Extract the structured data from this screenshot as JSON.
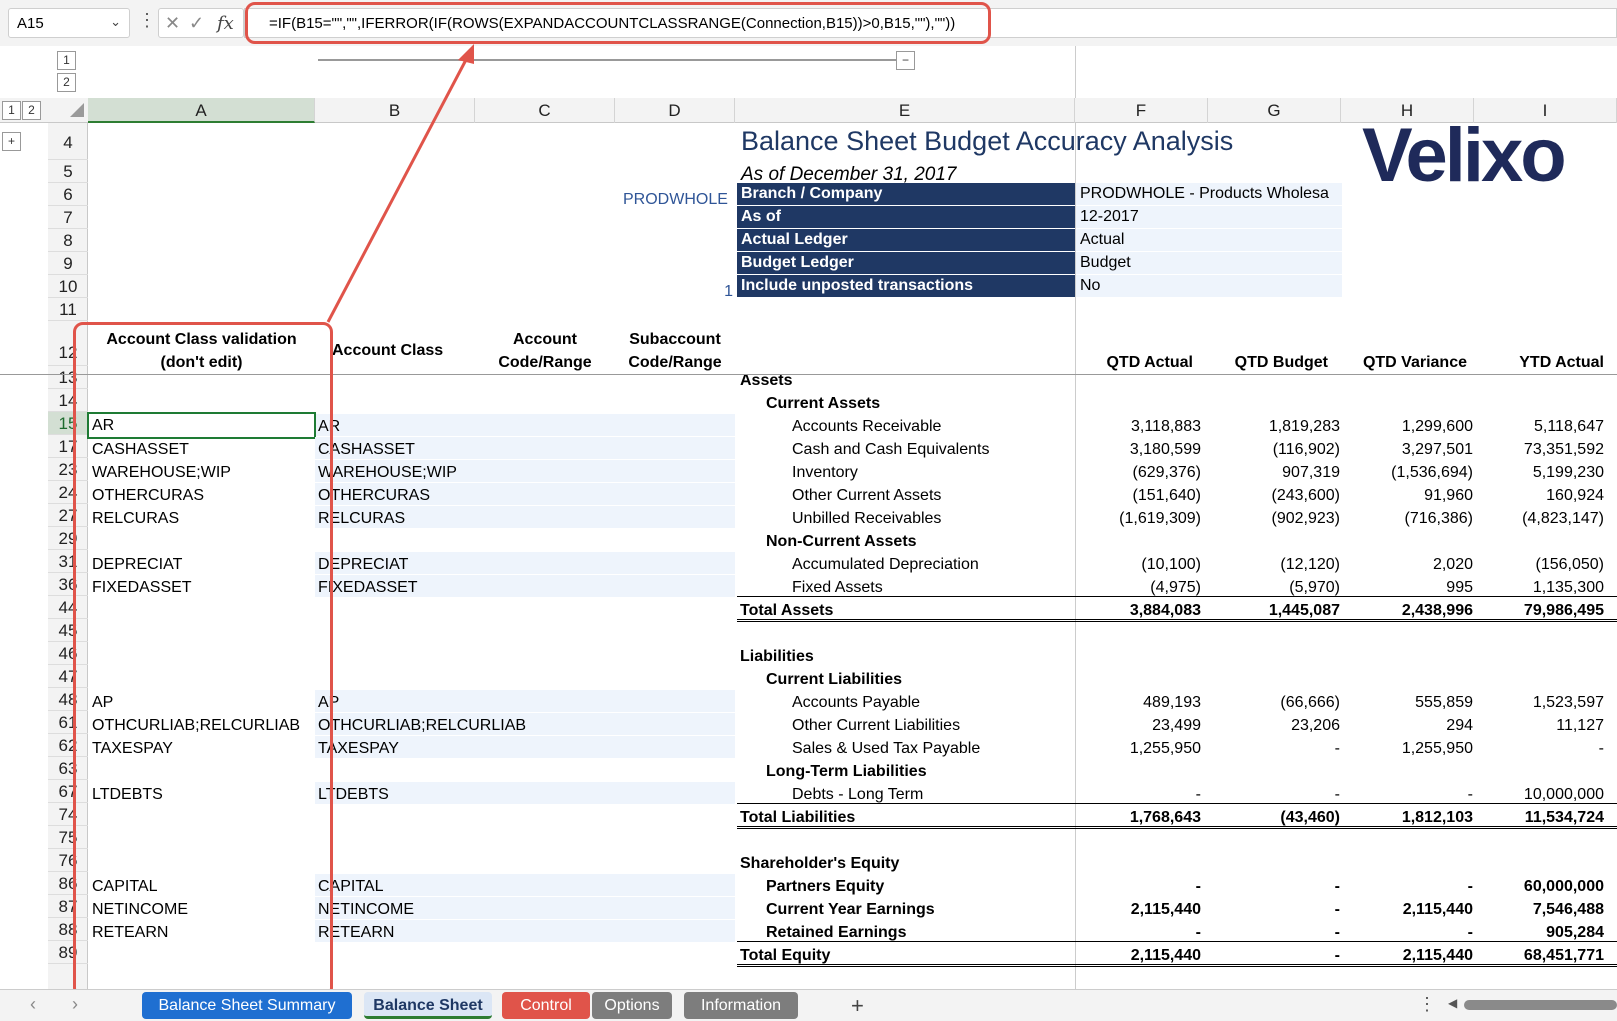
{
  "formula_bar": {
    "name_box": "A15",
    "fx": "fx",
    "formula": "=IF(B15=\"\",\"\",IFERROR(IF(ROWS(EXPANDACCOUNTCLASSRANGE(Connection,B15))>0,B15,\"\"),\"\"))"
  },
  "outline": {
    "levels": [
      "1",
      "2"
    ],
    "row_levels": [
      "1",
      "2"
    ],
    "expand": "+",
    "collapse": "−"
  },
  "columns": [
    "A",
    "B",
    "C",
    "D",
    "E",
    "F",
    "G",
    "H",
    "I"
  ],
  "rows": [
    "4",
    "5",
    "6",
    "7",
    "8",
    "9",
    "10",
    "11",
    "12",
    "13",
    "14",
    "15",
    "17",
    "23",
    "24",
    "27",
    "29",
    "31",
    "36",
    "44",
    "45",
    "46",
    "47",
    "48",
    "61",
    "62",
    "63",
    "67",
    "74",
    "75",
    "76",
    "86",
    "87",
    "88",
    "89"
  ],
  "report": {
    "title": "Balance Sheet Budget Accuracy Analysis",
    "subtitle": "As of December 31, 2017",
    "logo": "Velixo",
    "d6": "PRODWHOLE",
    "d10": "1",
    "params": [
      {
        "label": "Branch / Company",
        "value": "PRODWHOLE - Products Wholesa"
      },
      {
        "label": "As of",
        "value": "12-2017"
      },
      {
        "label": "Actual Ledger",
        "value": "Actual"
      },
      {
        "label": "Budget Ledger",
        "value": "Budget"
      },
      {
        "label": "Include unposted transactions",
        "value": "No"
      }
    ]
  },
  "headers": {
    "a": "Account Class validation (don't edit)",
    "b": "Account Class",
    "c1": "Account",
    "c2": "Code/Range",
    "d1": "Subaccount",
    "d2": "Code/Range",
    "f": "QTD Actual",
    "g": "QTD Budget",
    "h": "QTD Variance",
    "i": "YTD Actual"
  },
  "lines": [
    {
      "a": "",
      "b": "",
      "e": "Assets",
      "lvl": 0,
      "bold": true,
      "f": "",
      "g": "",
      "h": "",
      "i": ""
    },
    {
      "a": "",
      "b": "",
      "e": "Current Assets",
      "lvl": 1,
      "bold": true,
      "f": "",
      "g": "",
      "h": "",
      "i": ""
    },
    {
      "a": "AR",
      "b": "AR",
      "e": "Accounts Receivable",
      "lvl": 2,
      "bold": false,
      "f": "3,118,883",
      "g": "1,819,283",
      "h": "1,299,600",
      "i": "5,118,647"
    },
    {
      "a": "CASHASSET",
      "b": "CASHASSET",
      "e": "Cash and Cash Equivalents",
      "lvl": 2,
      "bold": false,
      "f": "3,180,599",
      "g": "(116,902)",
      "h": "3,297,501",
      "i": "73,351,592"
    },
    {
      "a": "WAREHOUSE;WIP",
      "b": "WAREHOUSE;WIP",
      "e": "Inventory",
      "lvl": 2,
      "bold": false,
      "f": "(629,376)",
      "g": "907,319",
      "h": "(1,536,694)",
      "i": "5,199,230"
    },
    {
      "a": "OTHERCURAS",
      "b": "OTHERCURAS",
      "e": "Other Current Assets",
      "lvl": 2,
      "bold": false,
      "f": "(151,640)",
      "g": "(243,600)",
      "h": "91,960",
      "i": "160,924"
    },
    {
      "a": "RELCURAS",
      "b": "RELCURAS",
      "e": "Unbilled Receivables",
      "lvl": 2,
      "bold": false,
      "f": "(1,619,309)",
      "g": "(902,923)",
      "h": "(716,386)",
      "i": "(4,823,147)"
    },
    {
      "a": "",
      "b": "",
      "e": "Non-Current Assets",
      "lvl": 1,
      "bold": true,
      "f": "",
      "g": "",
      "h": "",
      "i": ""
    },
    {
      "a": "DEPRECIAT",
      "b": "DEPRECIAT",
      "e": "Accumulated Depreciation",
      "lvl": 2,
      "bold": false,
      "f": "(10,100)",
      "g": "(12,120)",
      "h": "2,020",
      "i": "(156,050)"
    },
    {
      "a": "FIXEDASSET",
      "b": "FIXEDASSET",
      "e": "Fixed Assets",
      "lvl": 2,
      "bold": false,
      "f": "(4,975)",
      "g": "(5,970)",
      "h": "995",
      "i": "1,135,300"
    },
    {
      "a": "",
      "b": "",
      "e": "Total Assets",
      "lvl": 0,
      "bold": true,
      "total": true,
      "f": "3,884,083",
      "g": "1,445,087",
      "h": "2,438,996",
      "i": "79,986,495"
    },
    {
      "a": "",
      "b": "",
      "e": "",
      "lvl": 0,
      "bold": false,
      "f": "",
      "g": "",
      "h": "",
      "i": ""
    },
    {
      "a": "",
      "b": "",
      "e": "Liabilities",
      "lvl": 0,
      "bold": true,
      "f": "",
      "g": "",
      "h": "",
      "i": ""
    },
    {
      "a": "",
      "b": "",
      "e": "Current Liabilities",
      "lvl": 1,
      "bold": true,
      "f": "",
      "g": "",
      "h": "",
      "i": ""
    },
    {
      "a": "AP",
      "b": "AP",
      "e": "Accounts Payable",
      "lvl": 2,
      "bold": false,
      "f": "489,193",
      "g": "(66,666)",
      "h": "555,859",
      "i": "1,523,597"
    },
    {
      "a": "OTHCURLIAB;RELCURLIAB",
      "b": "OTHCURLIAB;RELCURLIAB",
      "e": "Other Current Liabilities",
      "lvl": 2,
      "bold": false,
      "f": "23,499",
      "g": "23,206",
      "h": "294",
      "i": "11,127"
    },
    {
      "a": "TAXESPAY",
      "b": "TAXESPAY",
      "e": "Sales & Used Tax Payable",
      "lvl": 2,
      "bold": false,
      "f": "1,255,950",
      "g": "-",
      "h": "1,255,950",
      "i": "-"
    },
    {
      "a": "",
      "b": "",
      "e": "Long-Term Liabilities",
      "lvl": 1,
      "bold": true,
      "f": "",
      "g": "",
      "h": "",
      "i": ""
    },
    {
      "a": "LTDEBTS",
      "b": "LTDEBTS",
      "e": "Debts - Long Term",
      "lvl": 2,
      "bold": false,
      "f": "-",
      "g": "-",
      "h": "-",
      "i": "10,000,000"
    },
    {
      "a": "",
      "b": "",
      "e": "Total Liabilities",
      "lvl": 0,
      "bold": true,
      "total": true,
      "f": "1,768,643",
      "g": "(43,460)",
      "h": "1,812,103",
      "i": "11,534,724"
    },
    {
      "a": "",
      "b": "",
      "e": "",
      "lvl": 0,
      "bold": false,
      "f": "",
      "g": "",
      "h": "",
      "i": ""
    },
    {
      "a": "",
      "b": "",
      "e": "Shareholder's Equity",
      "lvl": 0,
      "bold": true,
      "f": "",
      "g": "",
      "h": "",
      "i": ""
    },
    {
      "a": "CAPITAL",
      "b": "CAPITAL",
      "e": "Partners Equity",
      "lvl": 1,
      "bold": true,
      "f": "-",
      "g": "-",
      "h": "-",
      "i": "60,000,000"
    },
    {
      "a": "NETINCOME",
      "b": "NETINCOME",
      "e": "Current Year Earnings",
      "lvl": 1,
      "bold": true,
      "f": "2,115,440",
      "g": "-",
      "h": "2,115,440",
      "i": "7,546,488"
    },
    {
      "a": "RETEARN",
      "b": "RETEARN",
      "e": "Retained Earnings",
      "lvl": 1,
      "bold": true,
      "f": "-",
      "g": "-",
      "h": "-",
      "i": "905,284"
    },
    {
      "a": "",
      "b": "",
      "e": "Total Equity",
      "lvl": 0,
      "bold": true,
      "total": true,
      "f": "2,115,440",
      "g": "-",
      "h": "2,115,440",
      "i": "68,451,771"
    }
  ],
  "tabs": [
    {
      "label": "Balance Sheet Summary",
      "color": "#1f6fd1"
    },
    {
      "label": "Balance Sheet",
      "color": "#dbe6f5"
    },
    {
      "label": "Control",
      "color": "#e0544a"
    },
    {
      "label": "Options",
      "color": "#7d7d7d"
    },
    {
      "label": "Information",
      "color": "#7d7d7d"
    }
  ],
  "add_sheet": "+",
  "colors": {
    "header_navy": "#1f3864",
    "input_blue": "#eef4fc",
    "highlight_red": "#e0544a"
  }
}
